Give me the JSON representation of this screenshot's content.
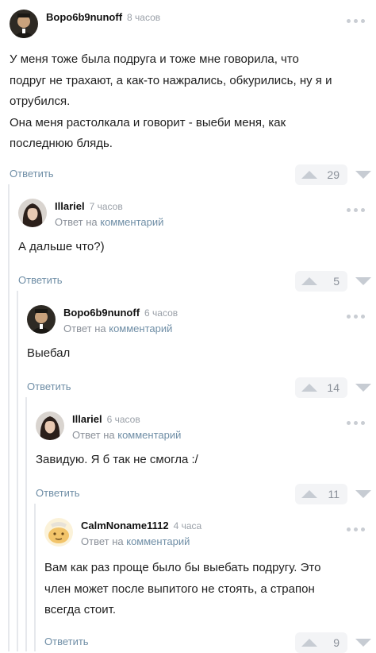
{
  "comments": [
    {
      "author": "Bopo6b9nunoff",
      "time": "8 часов",
      "avatar": "portrait-man-icon",
      "lines": [
        "У меня тоже была подруга и тоже мне говорила, что",
        "подруг не трахают, а как-то нажрались, обкурились, ну я и",
        "отрубился.",
        "Она меня растолкала и говорит - выеби меня, как",
        "последнюю блядь."
      ],
      "reply_label": "Ответить",
      "score": "29"
    },
    {
      "author": "Illariel",
      "time": "7 часов",
      "avatar": "portrait-woman-icon",
      "reply_prefix": "Ответ на",
      "reply_link": "комментарий",
      "lines": [
        "А дальше что?)"
      ],
      "reply_label": "Ответить",
      "score": "5"
    },
    {
      "author": "Bopo6b9nunoff",
      "time": "6 часов",
      "avatar": "portrait-man-icon",
      "reply_prefix": "Ответ на",
      "reply_link": "комментарий",
      "lines": [
        "Выебал"
      ],
      "reply_label": "Ответить",
      "score": "14"
    },
    {
      "author": "Illariel",
      "time": "6 часов",
      "avatar": "portrait-woman-icon",
      "reply_prefix": "Ответ на",
      "reply_link": "комментарий",
      "lines": [
        "Завидую. Я б так не смогла :/"
      ],
      "reply_label": "Ответить",
      "score": "11"
    },
    {
      "author": "CalmNoname1112",
      "time": "4 часа",
      "avatar": "cartoon-face-icon",
      "reply_prefix": "Ответ на",
      "reply_link": "комментарий",
      "lines": [
        "Вам как раз проще было бы выебать подругу. Это",
        "член может после выпитого не стоять, а страпон",
        "всегда стоит."
      ],
      "reply_label": "Ответить",
      "score": "9"
    }
  ],
  "colors": {
    "link": "#6f8ea6",
    "muted": "#9aa0a8",
    "thread_line": "#e6e8ec",
    "rating_bg": "#f3f4f6"
  }
}
